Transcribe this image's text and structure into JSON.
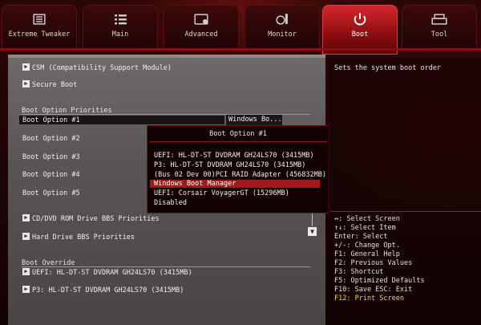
{
  "tabs": [
    {
      "label": "Extreme Tweaker",
      "icon": "tweaker-icon"
    },
    {
      "label": "Main",
      "icon": "list-icon"
    },
    {
      "label": "Advanced",
      "icon": "advanced-icon"
    },
    {
      "label": "Monitor",
      "icon": "monitor-icon"
    },
    {
      "label": "Boot",
      "icon": "power-icon"
    },
    {
      "label": "Tool",
      "icon": "tool-icon"
    }
  ],
  "main": {
    "csm": "CSM (Compatibility Support Module)",
    "secure_boot": "Secure Boot",
    "priorities_header": "Boot Option Priorities",
    "boot_options": [
      "Boot Option #1",
      "Boot Option #2",
      "Boot Option #3",
      "Boot Option #4",
      "Boot Option #5"
    ],
    "boot_option1_value": "Windows Bo...",
    "cd_dvd_bbs": "CD/DVD ROM Drive BBS Priorities",
    "hdd_bbs": "Hard Drive BBS Priorities",
    "override_header": "Boot Override",
    "overrides": [
      "UEFI: HL-DT-ST DVDRAM GH24LS70  (3415MB)",
      "P3: HL-DT-ST DVDRAM GH24LS70  (3415MB)"
    ]
  },
  "popup": {
    "title": "Boot Option #1",
    "options": [
      "UEFI: HL-DT-ST DVDRAM GH24LS70  (3415MB)",
      "P3: HL-DT-ST DVDRAM GH24LS70  (3415MB)",
      "(Bus 02 Dev 00)PCI RAID Adapter  (456832MB)",
      "Windows Boot Manager",
      "UEFI: Corsair VoyagerGT (15296MB)",
      "Disabled"
    ],
    "selected_index": 3
  },
  "help": {
    "text": "Sets the system boot order",
    "keys": [
      "↔: Select Screen",
      "↑↓: Select Item",
      "Enter: Select",
      "+/-: Change Opt.",
      "F1: General Help",
      "F2: Previous Values",
      "F3: Shortcut",
      "F5: Optimized Defaults",
      "F10: Save  ESC: Exit",
      "F12: Print Screen"
    ]
  },
  "colors": {
    "accent": "#a4181c",
    "hotkey": "#ffd23a"
  }
}
